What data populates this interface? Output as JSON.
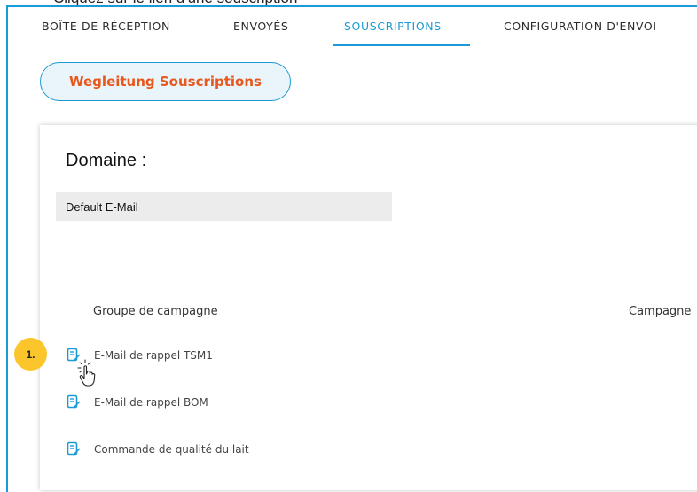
{
  "tabs": [
    {
      "label": "BOÎTE DE RÉCEPTION",
      "active": false
    },
    {
      "label": "ENVOYÉS",
      "active": false
    },
    {
      "label": "SOUSCRIPTIONS",
      "active": true
    },
    {
      "label": "CONFIGURATION D'ENVOI",
      "active": false
    }
  ],
  "guide_button": {
    "label": "Wegleitung Souscriptions"
  },
  "domain": {
    "title": "Domaine :",
    "selected": "Default E-Mail"
  },
  "table": {
    "columns": [
      "Groupe de campagne",
      "Campagne"
    ],
    "rows": [
      {
        "label": "E-Mail de rappel TSM1",
        "icon": "edit-icon"
      },
      {
        "label": "E-Mail de rappel BOM",
        "icon": "edit-icon"
      },
      {
        "label": "Commande de qualité du lait",
        "icon": "edit-icon"
      }
    ]
  },
  "annotation": {
    "step": "1."
  },
  "colors": {
    "accent": "#1a9ad6",
    "guide_text": "#e8571c",
    "badge": "#fbc52c"
  }
}
